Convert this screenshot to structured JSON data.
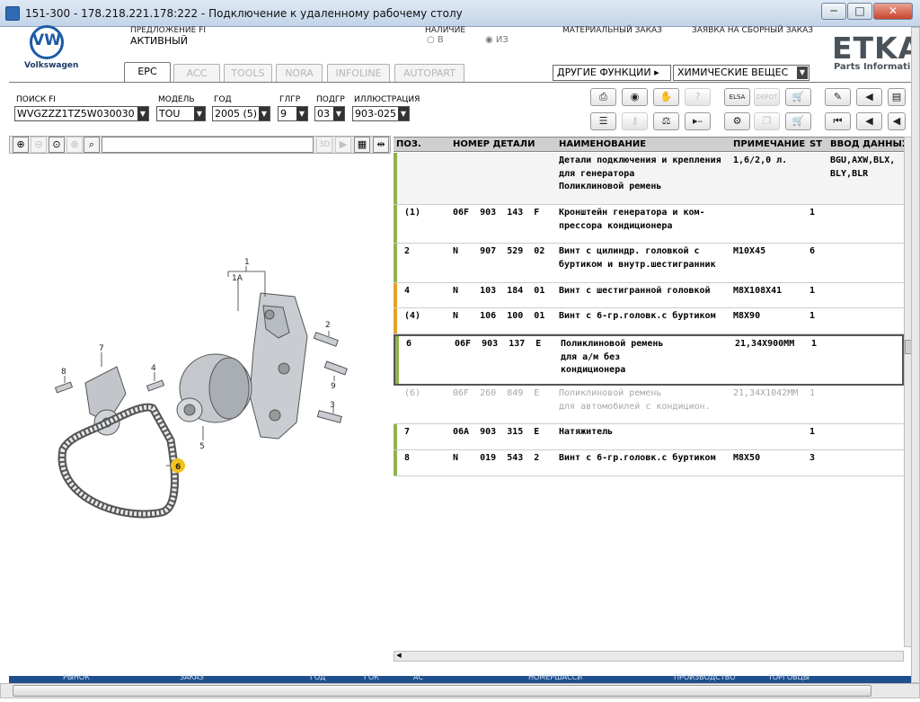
{
  "window": {
    "title": "151-300 - 178.218.221.178:222 - Подключение к удаленному рабочему столу",
    "min": "─",
    "max": "□",
    "close": "✕"
  },
  "brand": {
    "logo_text": "VW",
    "name": "Volkswagen",
    "etka": "ETKA",
    "etka_sub": "Parts Informati"
  },
  "header": {
    "offer_label": "ПРЕДЛОЖЕНИЕ FI",
    "offer_value": "АКТИВНЫЙ",
    "stock_label": "НАЛИЧИЕ",
    "stock_in": "В",
    "stock_out": "ИЗ",
    "material_order": "МАТЕРИАЛЬНЫЙ ЗАКАЗ",
    "assembly_order": "ЗАЯВКА НА СБОРНЫЙ ЗАКАЗ"
  },
  "tabs": [
    "EPC",
    "ACC",
    "TOOLS",
    "NORA",
    "INFOLINE",
    "AUTOPART"
  ],
  "functions": {
    "other": "ДРУГИЕ ФУНКЦИИ",
    "chem": "ХИМИЧЕСКИЕ ВЕЩЕС"
  },
  "filters": {
    "search_label": "ПОИСК FI",
    "search_value": "WVGZZZ1TZ5W030030",
    "model_label": "МОДЕЛЬ",
    "model_value": "TOU",
    "year_label": "ГОД",
    "year_value": "2005 (5)",
    "mg_label": "ГЛГР",
    "mg_value": "9",
    "sg_label": "ПОДГР",
    "sg_value": "03",
    "ill_label": "ИЛЛЮСТРАЦИЯ",
    "ill_value": "903-025"
  },
  "toolbar": {
    "elsa": "ELSA",
    "depot": "DEPOT"
  },
  "zoom": {
    "label_3d": "3D"
  },
  "table": {
    "headers": {
      "pos": "ПОЗ.",
      "part": "НОМЕР ДЕТАЛИ",
      "name": "НАИМЕНОВАНИЕ",
      "note": "ПРИМЕЧАНИЕ",
      "st": "ST",
      "data": "ВВОД ДАННЫХ"
    },
    "rows": [
      {
        "pos": "",
        "part": "",
        "name": "Детали подключения и крепления\nдля генератора\nПоликлиновой ремень",
        "note": "1,6/2,0 л.",
        "st": "",
        "data": "BGU,AXW,BLX,\nBLY,BLR",
        "bar": "#8fb24f"
      },
      {
        "pos": "(1)",
        "part": "06F  903  143  F",
        "name": "Кронштейн генератора и ком-\nпрессора кондиционера",
        "note": "",
        "st": "1",
        "data": "",
        "bar": "#8fb24f"
      },
      {
        "pos": "2",
        "part": "N    907  529  02",
        "name": "Винт с цилиндр. головкой с\nбуртиком и внутр.шестигранник",
        "note": "M10X45",
        "st": "6",
        "data": "",
        "bar": "#8fb24f"
      },
      {
        "pos": "4",
        "part": "N    103  184  01",
        "name": "Винт с шестигранной головкой",
        "note": "M8X108X41",
        "st": "1",
        "data": "",
        "bar": "#e0a32a"
      },
      {
        "pos": "(4)",
        "part": "N    106  100  01",
        "name": "Винт с 6-гр.головк.с буртиком",
        "note": "M8X90",
        "st": "1",
        "data": "",
        "bar": "#e0a32a"
      },
      {
        "pos": "6",
        "part": "06F  903  137  E",
        "name": "Поликлиновой ремень\nдля а/м без\nкондиционера",
        "note": "21,34X900MM",
        "st": "1",
        "data": "",
        "bar": "#8fb24f"
      },
      {
        "pos": "(6)",
        "part": "06F  260  849  E",
        "name": "Поликлиновой ремень\nдля автомобилей с кондицион.",
        "note": "21,34X1042MM",
        "st": "1",
        "data": "",
        "bar": ""
      },
      {
        "pos": "7",
        "part": "06A  903  315  E",
        "name": "Натяжитель",
        "note": "",
        "st": "1",
        "data": "",
        "bar": "#8fb24f"
      },
      {
        "pos": "8",
        "part": "N    019  543  2",
        "name": "Винт с 6-гр.головк.с буртиком",
        "note": "M8X50",
        "st": "3",
        "data": "",
        "bar": "#8fb24f"
      }
    ]
  },
  "diagram": {
    "callouts": [
      "1",
      "1A",
      "2",
      "3",
      "4",
      "5",
      "6",
      "7",
      "8",
      "9"
    ]
  },
  "statusbar": {
    "items": [
      "РЫНОК",
      "ЗАКАЗ",
      "ГОД",
      "ГОК",
      "АС",
      "НОМЕРШАССИ",
      "ПРОИЗВОДСТВО",
      "ТОРГОВЦЫ"
    ]
  },
  "colors": {
    "accent": "#1c5aa6",
    "highlight": "#f2c21b",
    "green_bar": "#8fb24f",
    "orange_bar": "#e0a32a"
  }
}
